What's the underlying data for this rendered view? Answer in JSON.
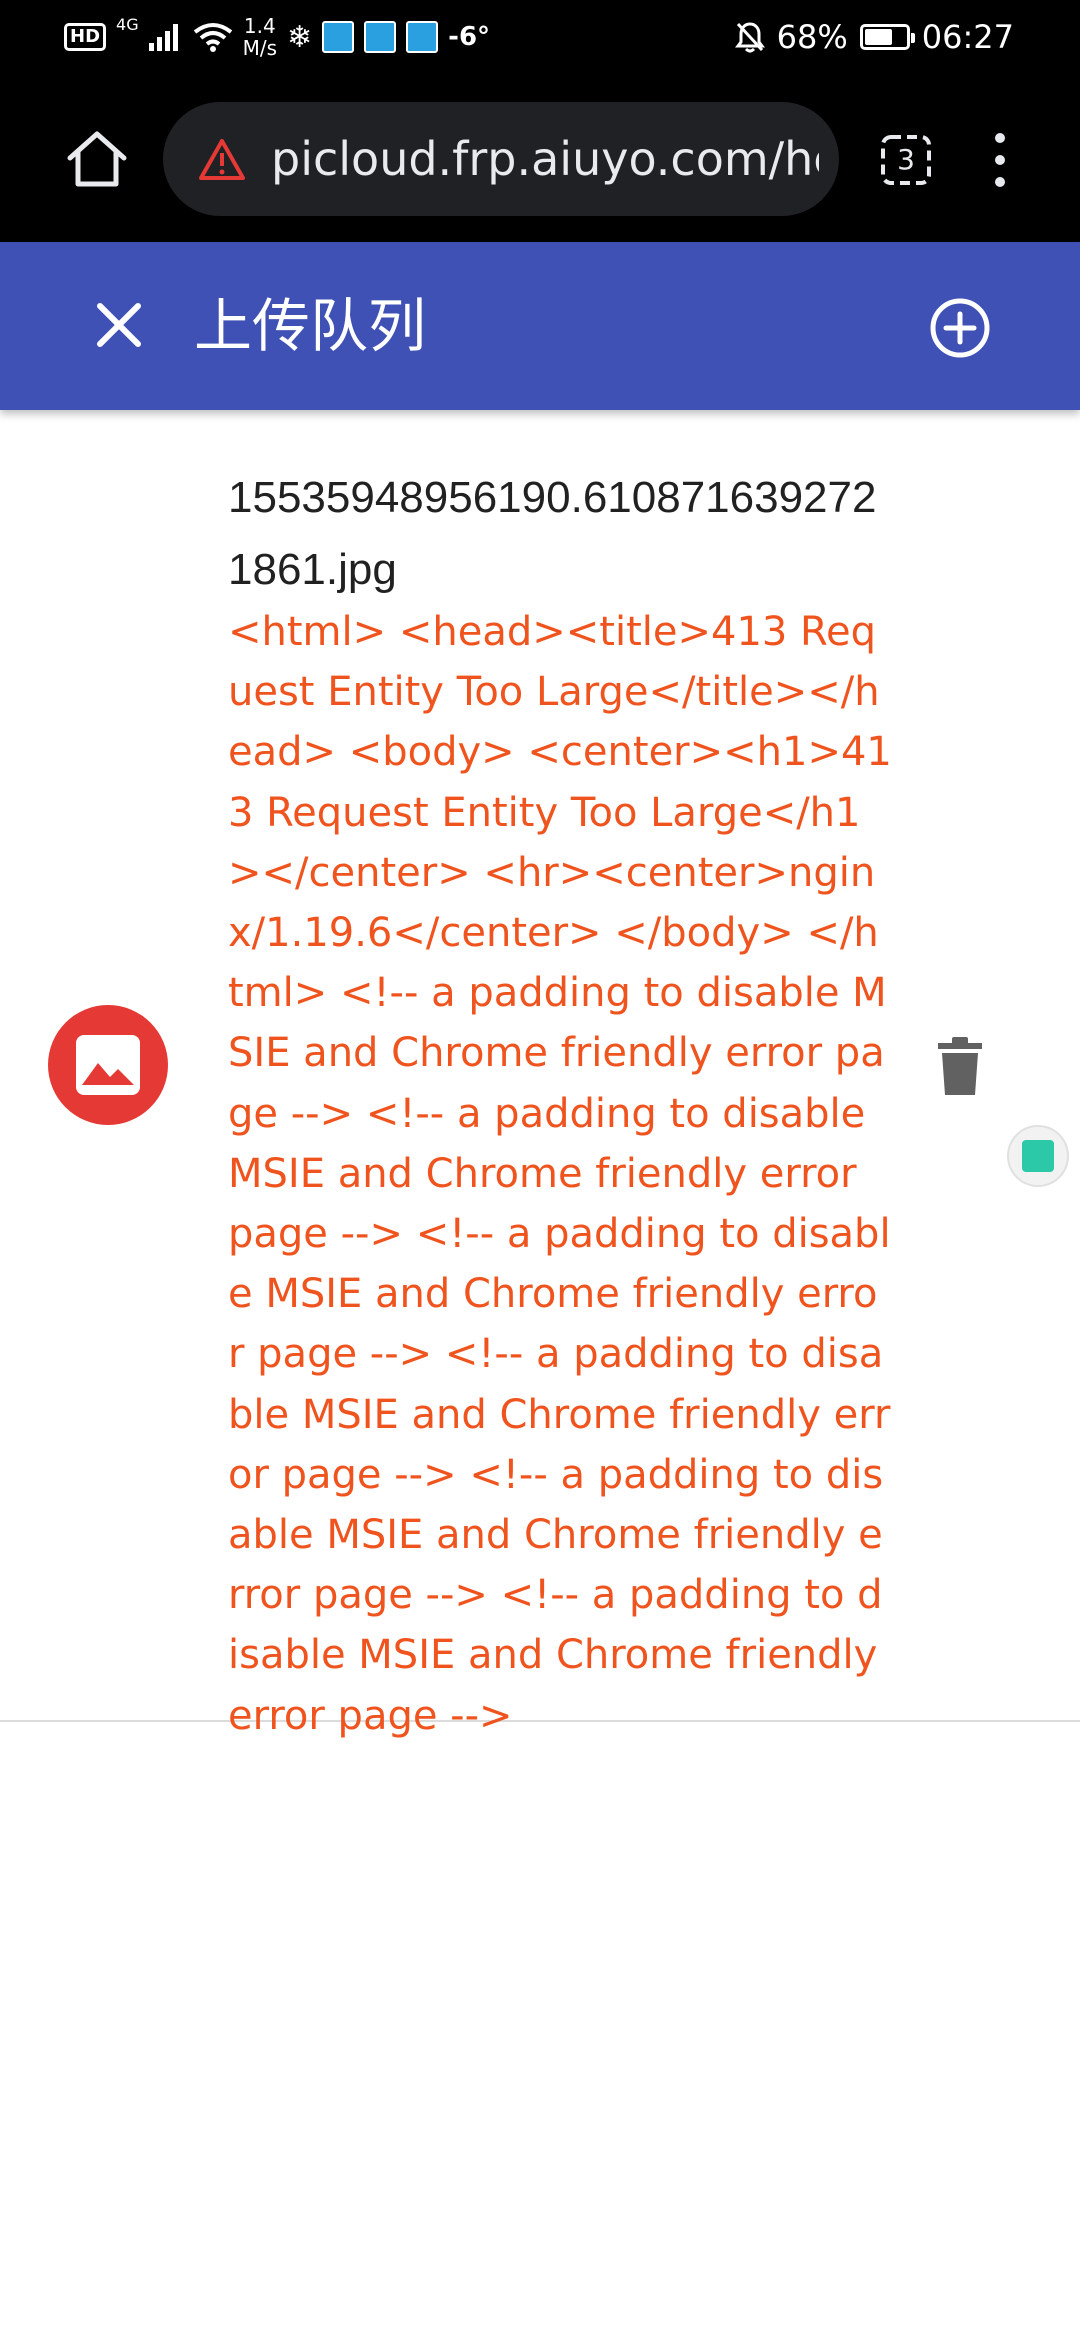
{
  "status_bar": {
    "hd_label": "HD",
    "network_label": "4G",
    "speed_value": "1.4",
    "speed_unit": "M/s",
    "temperature": "-6°",
    "battery_percent": "68%",
    "battery_level": 0.68,
    "time": "06:27"
  },
  "browser": {
    "url": "picloud.frp.aiuyo.com/hc",
    "tab_count": "3"
  },
  "header": {
    "title": "上传队列"
  },
  "upload_item": {
    "file_name": "15535948956190.6108716392721861.jpg",
    "error_message": "<html> <head><title>413 Request Entity Too Large</title></head> <body> <center><h1>413 Request Entity Too Large</h1></center> <hr><center>nginx/1.19.6</center> </body> </html> <!-- a padding to disable MSIE and Chrome friendly error page --> <!-- a padding to disable MSIE and Chrome friendly error page --> <!-- a padding to disable MSIE and Chrome friendly error page --> <!-- a padding to disable MSIE and Chrome friendly error page --> <!-- a padding to disable MSIE and Chrome friendly error page --> <!-- a padding to disable MSIE and Chrome friendly error page -->"
  },
  "colors": {
    "header_bg": "#3f51b5",
    "error_text": "#f0541e",
    "thumb_bg": "#e53935"
  },
  "icons": [
    "home-icon",
    "warning-icon",
    "tabs-icon",
    "more-vert-icon",
    "close-icon",
    "add-circle-icon",
    "image-icon",
    "delete-icon"
  ]
}
